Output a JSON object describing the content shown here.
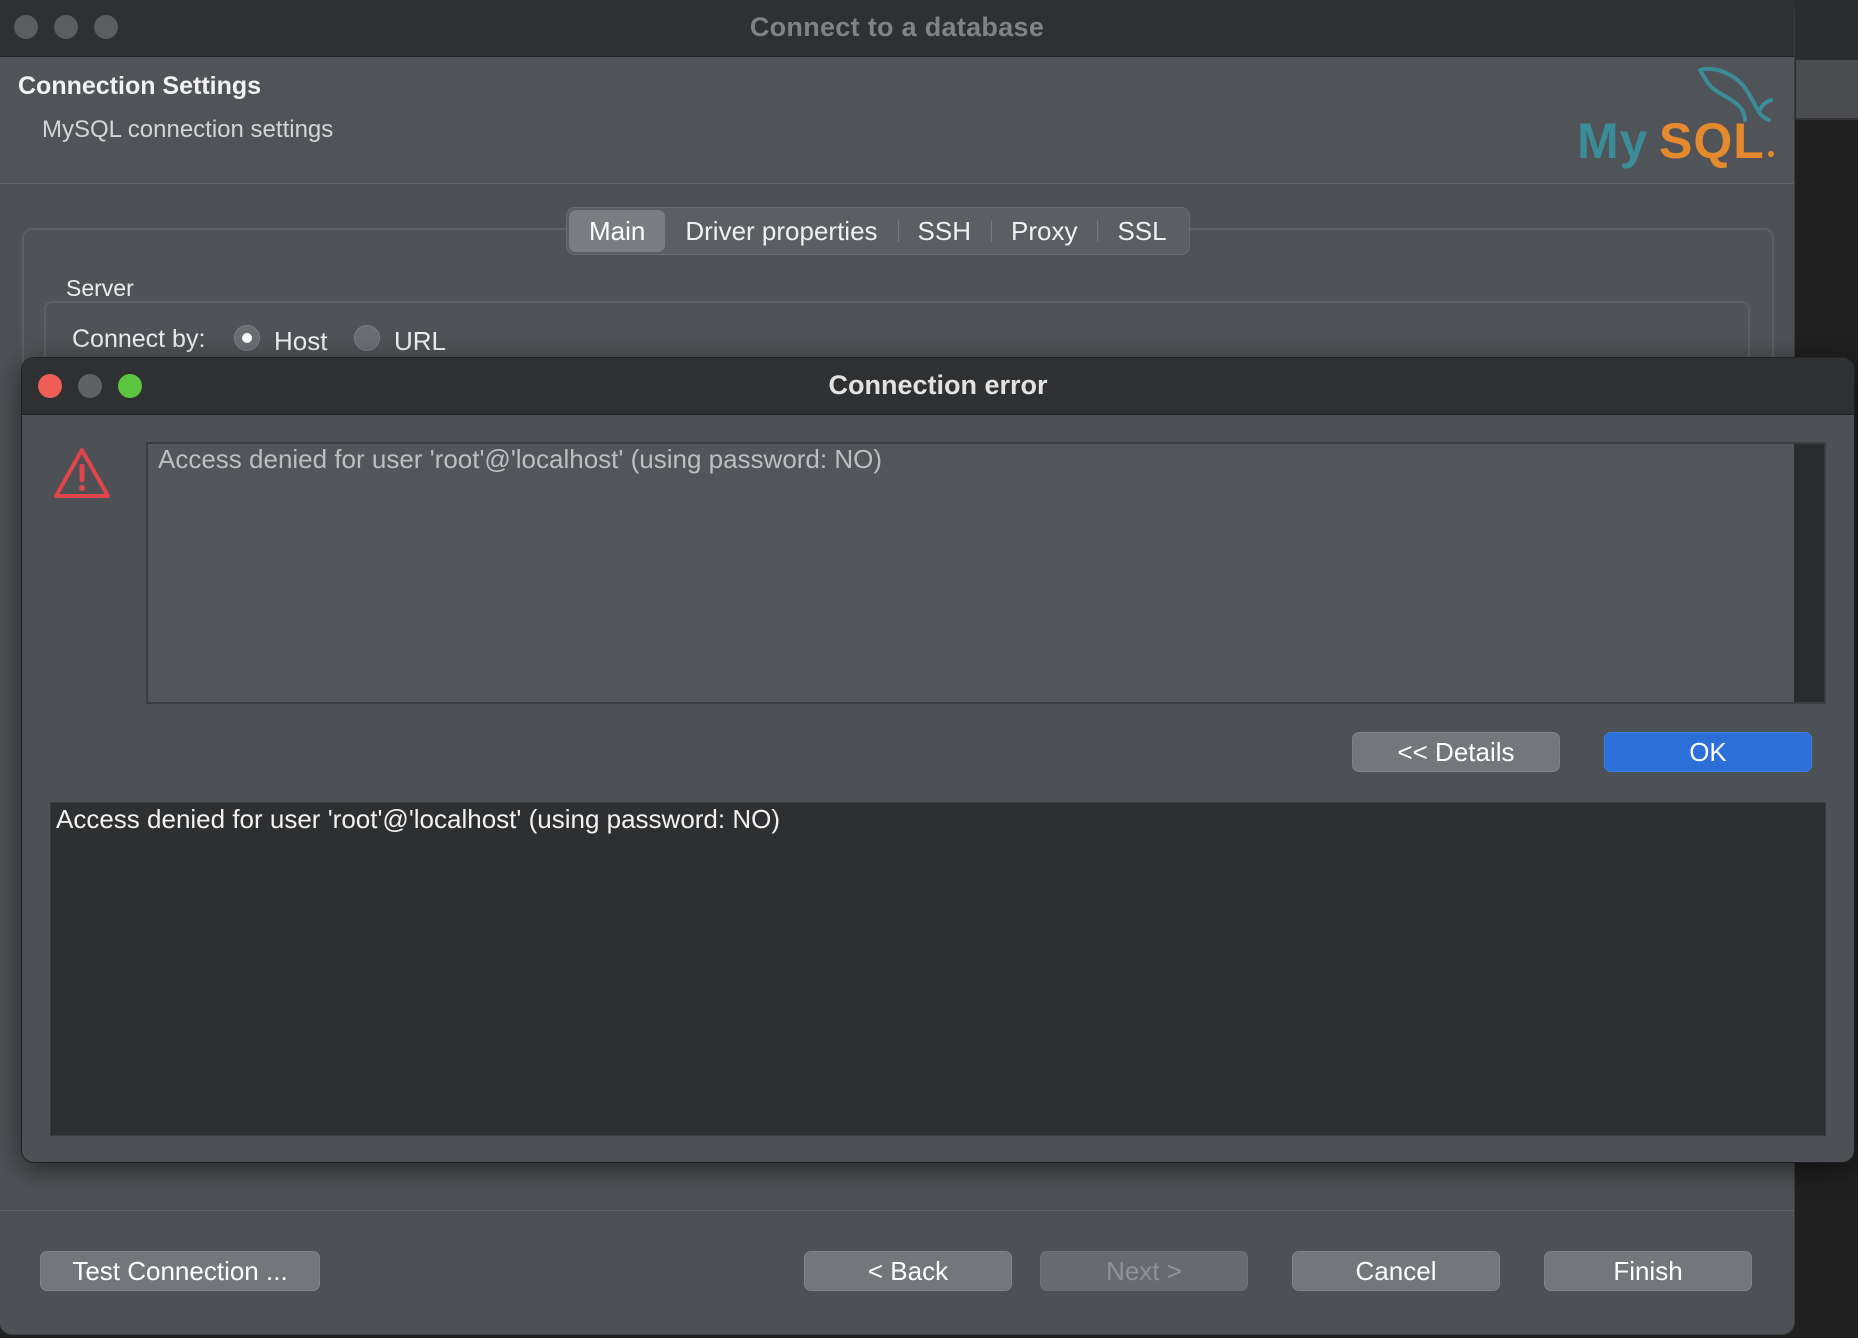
{
  "main_window": {
    "title": "Connect to a database",
    "section_title": "Connection Settings",
    "section_subtitle": "MySQL connection settings",
    "logo_text": "MySQL",
    "tabs": [
      {
        "label": "Main",
        "active": true
      },
      {
        "label": "Driver properties",
        "active": false
      },
      {
        "label": "SSH",
        "active": false
      },
      {
        "label": "Proxy",
        "active": false
      },
      {
        "label": "SSL",
        "active": false
      }
    ],
    "server_group_label": "Server",
    "connect_by_label": "Connect by:",
    "connect_by_options": [
      {
        "label": "Host",
        "selected": true
      },
      {
        "label": "URL",
        "selected": false
      }
    ],
    "footer_buttons": {
      "test_connection": "Test Connection ...",
      "back": "< Back",
      "next": "Next >",
      "cancel": "Cancel",
      "finish": "Finish"
    }
  },
  "error_dialog": {
    "title": "Connection error",
    "icon": "warning-triangle-icon",
    "message": "Access denied for user 'root'@'localhost' (using password: NO)",
    "details_button": "<< Details",
    "ok_button": "OK",
    "details_text": "Access denied for user 'root'@'localhost' (using password: NO)"
  },
  "colors": {
    "accent_blue": "#2c6fd8",
    "warning_red": "#e0454a",
    "mysql_teal": "#3b8c99",
    "mysql_orange": "#e58a2c"
  }
}
